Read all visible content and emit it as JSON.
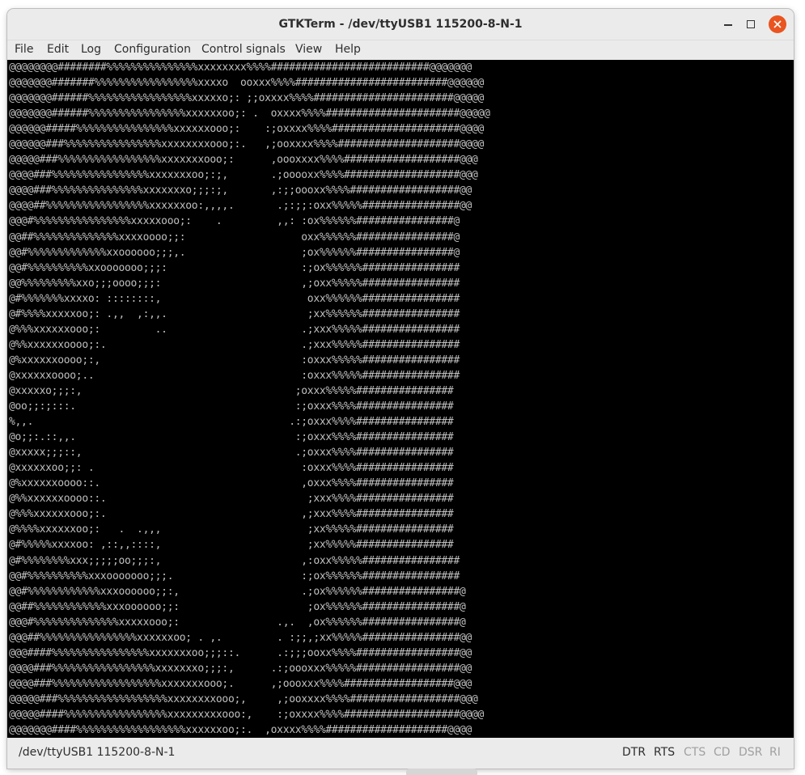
{
  "window": {
    "title": "GTKTerm - /dev/ttyUSB1  115200-8-N-1"
  },
  "menubar": [
    "File",
    "Edit",
    "Log",
    "Configuration",
    "Control signals",
    "View",
    "Help"
  ],
  "terminal": {
    "lines": [
      "@@@@@@@@########%%%%%%%%%%%%%%%xxxxxxxx%%%%##########################@@@@@@@",
      "@@@@@@@#######%%%%%%%%%%%%%%%%%xxxxo  ooxxx%%%%#########################@@@@@@",
      "@@@@@@@######%%%%%%%%%%%%%%%%%xxxxxo;: ;;oxxxx%%%%#######################@@@@@",
      "@@@@@@@######%%%%%%%%%%%%%%%%xxxxxxoo;: .  oxxxx%%%%######################@@@@@",
      "@@@@@@#####%%%%%%%%%%%%%%%%xxxxxxooo;:    :;oxxxx%%%%#####################@@@@",
      "@@@@@@###%%%%%%%%%%%%%%%%xxxxxxxxooo;:.   ,;ooxxxx%%%%####################@@@@",
      "@@@@@###%%%%%%%%%%%%%%%%%xxxxxxxooo;:      ,oooxxxx%%%%###################@@@",
      "@@@@###%%%%%%%%%%%%%%%%xxxxxxxoo;:;,       .;ooooxx%%%%###################@@@",
      "@@@@###%%%%%%%%%%%%%%%xxxxxxxo;;;:;,       ,:;;oooxx%%%%##################@@",
      "@@@@##%%%%%%%%%%%%%%%%%xxxxxxoo:,,,,.       .;:;;:oxx%%%%%################@@",
      "@@@#%%%%%%%%%%%%%%%%xxxxxooo;:    .         ,,: :ox%%%%%%################@",
      "@@##%%%%%%%%%%%%%%xxxxoooo;;:                   oxx%%%%%%################@",
      "@@#%%%%%%%%%%%%%xxoooooo;;;,.                   ;ox%%%%%%################@",
      "@@#%%%%%%%%%%xxooooooo;;;:                      :;ox%%%%%%################",
      "@@%%%%%%%%%xxo;;;oooo;;;:                       ,;oxx%%%%%################",
      "@#%%%%%%%xxxxo: ::::::::,                        oxx%%%%%%################",
      "@#%%%%xxxxxoo;: .,,  ,:,,.                       ;xx%%%%%%################",
      "@%%%xxxxxxooo;:         ..                      .;xxx%%%%%################",
      "@%%xxxxxxoooo;:.                                .;xxx%%%%%################",
      "@%xxxxxxoooo;:,                                 :oxxx%%%%%################",
      "@xxxxxxoooo;..                                  :oxxx%%%%%################",
      "@xxxxxo;;;:,                                   ;oxxx%%%%%################",
      "@oo;;:;:::.                                    :;oxxx%%%%################",
      "%,,.                                          .:;oxxx%%%%################",
      "@o;;:.::,,.                                    :;oxxx%%%%################",
      "@xxxxx;;;::,                                   .;oxxx%%%%################",
      "@xxxxxxoo;;: .                                  :oxxx%%%%################",
      "@%xxxxxxoooo::.                                 ,oxxx%%%%################",
      "@%%xxxxxxoooo::.                                 ;xxx%%%%################",
      "@%%%xxxxxxooo;:.                                ,;xxx%%%%################",
      "@%%%%xxxxxxoo;:   .  .,,,                        ;xx%%%%%################",
      "@#%%%%%xxxxoo: ,::,,::::,                        ;xx%%%%%################",
      "@#%%%%%%%%xxx;;;;;oo;;;:,                       ,:oxx%%%%%################",
      "@@#%%%%%%%%%%xxxooooooo;;;.                     :;ox%%%%%%################",
      "@@#%%%%%%%%%%%%xxxoooooo;;:,                    .;ox%%%%%%################@",
      "@@##%%%%%%%%%%%%xxxoooooo;;:                     ;ox%%%%%%################@",
      "@@@#%%%%%%%%%%%%%%xxxxxooo;:                .,.  ,ox%%%%%%################@",
      "@@@##%%%%%%%%%%%%%%%%xxxxxxoo; . ,.         . :;;,;xx%%%%%################@@",
      "@@@####%%%%%%%%%%%%%%%%xxxxxxxoo;;;::.      .:;;;ooxx%%%%#################@@",
      "@@@@###%%%%%%%%%%%%%%%%%xxxxxxxo;;;:,      .:;oooxxx%%%%%#################@@",
      "@@@@###%%%%%%%%%%%%%%%%%%xxxxxxxooo;.      ,;oooxxx%%%%##################@@@",
      "@@@@@###%%%%%%%%%%%%%%%%%%xxxxxxxxooo;,     ,;ooxxxx%%%%##################@@@",
      "@@@@@####%%%%%%%%%%%%%%%%%xxxxxxxxxooo:,    :;oxxxx%%%%###################@@@@",
      "@@@@@@@####%%%%%%%%%%%%%%%%%%xxxxxxoo;:.  ,oxxxx%%%%####################@@@@"
    ]
  },
  "statusbar": {
    "port": "/dev/ttyUSB1  115200-8-N-1",
    "signals": [
      {
        "label": "DTR",
        "active": true
      },
      {
        "label": "RTS",
        "active": true
      },
      {
        "label": "CTS",
        "active": false
      },
      {
        "label": "CD",
        "active": false
      },
      {
        "label": "DSR",
        "active": false
      },
      {
        "label": "RI",
        "active": false
      }
    ]
  }
}
